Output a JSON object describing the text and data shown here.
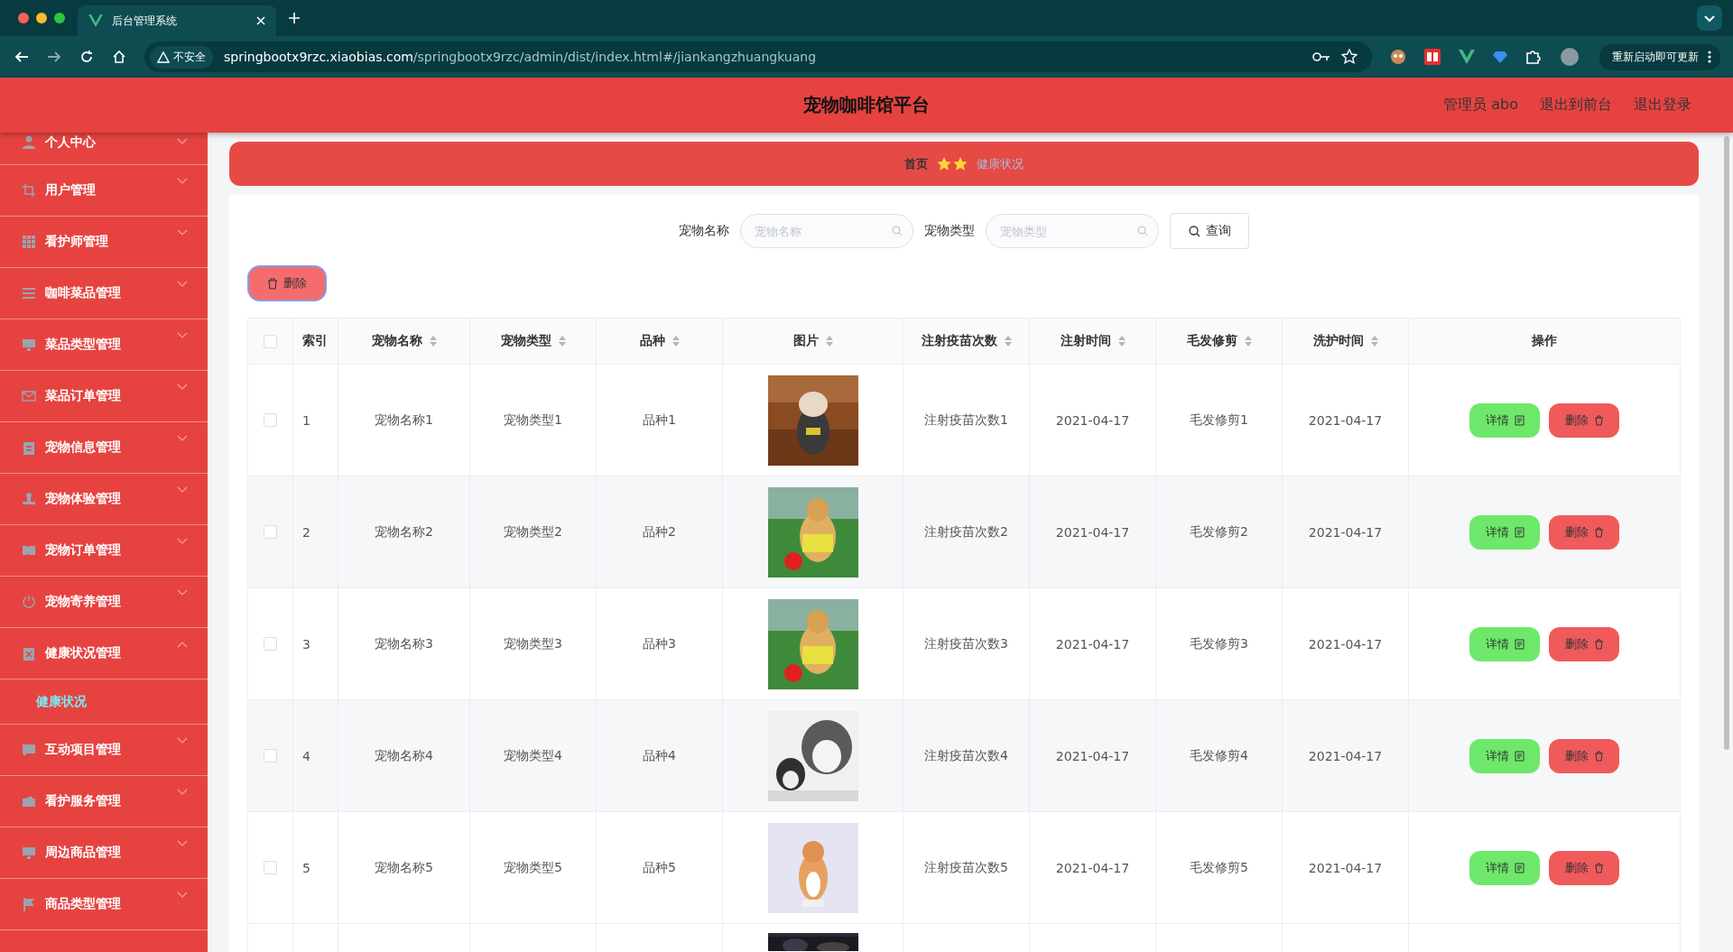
{
  "browser": {
    "tab_title": "后台管理系统",
    "security_label": "不安全",
    "url_host": "springbootx9rzc.xiaobias.com",
    "url_path": "/springbootx9rzc/admin/dist/index.html#/jiankangzhuangkuang",
    "update_button": "重新启动即可更新"
  },
  "header": {
    "title": "宠物咖啡馆平台",
    "links": [
      "管理员 abo",
      "退出到前台",
      "退出登录"
    ]
  },
  "sidebar": {
    "items": [
      {
        "label": "个人中心",
        "expanded": false
      },
      {
        "label": "用户管理",
        "expanded": false
      },
      {
        "label": "看护师管理",
        "expanded": false
      },
      {
        "label": "咖啡菜品管理",
        "expanded": false
      },
      {
        "label": "菜品类型管理",
        "expanded": false
      },
      {
        "label": "菜品订单管理",
        "expanded": false
      },
      {
        "label": "宠物信息管理",
        "expanded": false
      },
      {
        "label": "宠物体验管理",
        "expanded": false
      },
      {
        "label": "宠物订单管理",
        "expanded": false
      },
      {
        "label": "宠物寄养管理",
        "expanded": false
      },
      {
        "label": "健康状况管理",
        "expanded": true,
        "children": [
          {
            "label": "健康状况",
            "selected": true
          }
        ]
      },
      {
        "label": "互动项目管理",
        "expanded": false
      },
      {
        "label": "看护服务管理",
        "expanded": false
      },
      {
        "label": "周边商品管理",
        "expanded": false
      },
      {
        "label": "商品类型管理",
        "expanded": false
      }
    ]
  },
  "breadcrumb": [
    "首页",
    "健康状况"
  ],
  "search": {
    "fields": [
      {
        "label": "宠物名称",
        "placeholder": "宠物名称"
      },
      {
        "label": "宠物类型",
        "placeholder": "宠物类型"
      }
    ],
    "button": "查询"
  },
  "delete_button": "删除",
  "table": {
    "columns": [
      {
        "label": "索引",
        "sortable": false
      },
      {
        "label": "宠物名称",
        "sortable": true
      },
      {
        "label": "宠物类型",
        "sortable": true
      },
      {
        "label": "品种",
        "sortable": true
      },
      {
        "label": "图片",
        "sortable": true
      },
      {
        "label": "注射疫苗次数",
        "sortable": true
      },
      {
        "label": "注射时间",
        "sortable": true
      },
      {
        "label": "毛发修剪",
        "sortable": true
      },
      {
        "label": "洗护时间",
        "sortable": true
      },
      {
        "label": "操作",
        "sortable": false
      }
    ],
    "all_checked": false,
    "rows": [
      {
        "checked": false,
        "cells": [
          "1",
          "宠物名称1",
          "宠物类型1",
          "品种1"
        ],
        "after": [
          "注射疫苗次数1",
          "2021-04-17",
          "毛发修剪1",
          "2021-04-17"
        ],
        "actions": [
          "详情",
          "删除"
        ]
      },
      {
        "checked": false,
        "cells": [
          "2",
          "宠物名称2",
          "宠物类型2",
          "品种2"
        ],
        "after": [
          "注射疫苗次数2",
          "2021-04-17",
          "毛发修剪2",
          "2021-04-17"
        ],
        "actions": [
          "详情",
          "删除"
        ]
      },
      {
        "checked": false,
        "cells": [
          "3",
          "宠物名称3",
          "宠物类型3",
          "品种3"
        ],
        "after": [
          "注射疫苗次数3",
          "2021-04-17",
          "毛发修剪3",
          "2021-04-17"
        ],
        "actions": [
          "详情",
          "删除"
        ]
      },
      {
        "checked": false,
        "cells": [
          "4",
          "宠物名称4",
          "宠物类型4",
          "品种4"
        ],
        "after": [
          "注射疫苗次数4",
          "2021-04-17",
          "毛发修剪4",
          "2021-04-17"
        ],
        "actions": [
          "详情",
          "删除"
        ]
      },
      {
        "checked": false,
        "cells": [
          "5",
          "宠物名称5",
          "宠物类型5",
          "品种5"
        ],
        "after": [
          "注射疫苗次数5",
          "2021-04-17",
          "毛发修剪5",
          "2021-04-17"
        ],
        "actions": [
          "详情",
          "删除"
        ]
      }
    ]
  }
}
